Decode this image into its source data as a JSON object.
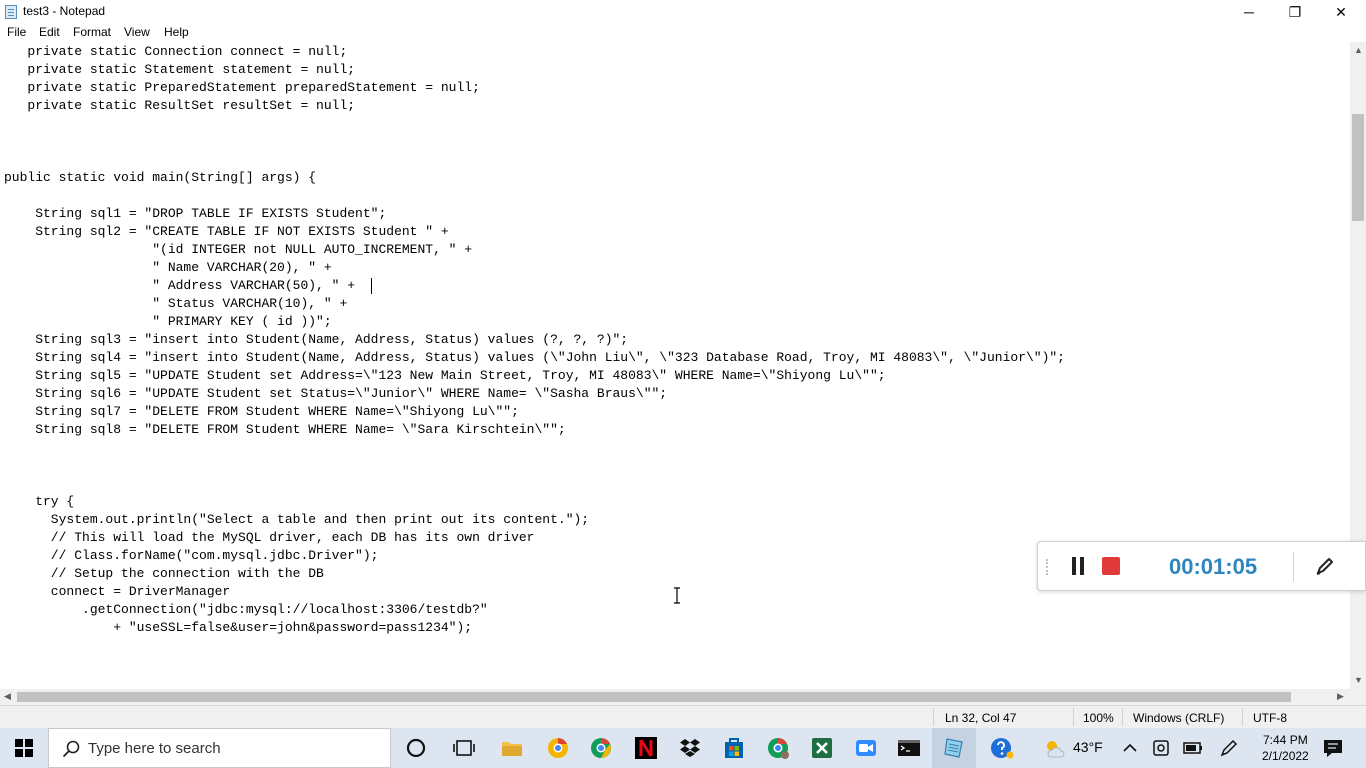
{
  "window": {
    "title": "test3 - Notepad",
    "controls": {
      "minimize": "─",
      "maximize": "❐",
      "close": "✕"
    }
  },
  "menu": [
    "File",
    "Edit",
    "Format",
    "View",
    "Help"
  ],
  "editor": {
    "lines": [
      "   private static Connection connect = null;",
      "   private static Statement statement = null;",
      "   private static PreparedStatement preparedStatement = null;",
      "   private static ResultSet resultSet = null;",
      "",
      "",
      "",
      "public static void main(String[] args) {",
      "",
      "    String sql1 = \"DROP TABLE IF EXISTS Student\";",
      "    String sql2 = \"CREATE TABLE IF NOT EXISTS Student \" +",
      "                   \"(id INTEGER not NULL AUTO_INCREMENT, \" +",
      "                   \" Name VARCHAR(20), \" +",
      "                   \" Address VARCHAR(50), \" + ",
      "                   \" Status VARCHAR(10), \" +",
      "                   \" PRIMARY KEY ( id ))\";",
      "    String sql3 = \"insert into Student(Name, Address, Status) values (?, ?, ?)\";",
      "    String sql4 = \"insert into Student(Name, Address, Status) values (\\\"John Liu\\\", \\\"323 Database Road, Troy, MI 48083\\\", \\\"Junior\\\")\";",
      "    String sql5 = \"UPDATE Student set Address=\\\"123 New Main Street, Troy, MI 48083\\\" WHERE Name=\\\"Shiyong Lu\\\"\";",
      "    String sql6 = \"UPDATE Student set Status=\\\"Junior\\\" WHERE Name= \\\"Sasha Braus\\\"\";",
      "    String sql7 = \"DELETE FROM Student WHERE Name=\\\"Shiyong Lu\\\"\";",
      "    String sql8 = \"DELETE FROM Student WHERE Name= \\\"Sara Kirschtein\\\"\";",
      "",
      "",
      "",
      "    try {",
      "      System.out.println(\"Select a table and then print out its content.\");",
      "      // This will load the MySQL driver, each DB has its own driver",
      "      // Class.forName(\"com.mysql.jdbc.Driver\");",
      "      // Setup the connection with the DB",
      "      connect = DriverManager",
      "          .getConnection(\"jdbc:mysql://localhost:3306/testdb?\"",
      "              + \"useSSL=false&user=john&password=pass1234\");"
    ]
  },
  "statusbar": {
    "position": "Ln 32, Col 47",
    "zoom": "100%",
    "line_ending": "Windows (CRLF)",
    "encoding": "UTF-8"
  },
  "recorder": {
    "timer": "00:01:05",
    "stop_color": "#e03a3a",
    "timer_color": "#2e86c1"
  },
  "taskbar": {
    "search_placeholder": "Type here to search",
    "weather": "43°F",
    "time": "7:44 PM",
    "date": "2/1/2022",
    "icons": [
      "windows-start-icon",
      "cortana-icon",
      "task-view-icon",
      "file-explorer-icon",
      "chrome-canary-icon",
      "chrome-icon",
      "netflix-icon",
      "dropbox-icon",
      "store-icon",
      "chrome-profile-icon",
      "excel-icon",
      "zoom-icon",
      "terminal-icon",
      "notepad-icon",
      "help-icon"
    ]
  }
}
